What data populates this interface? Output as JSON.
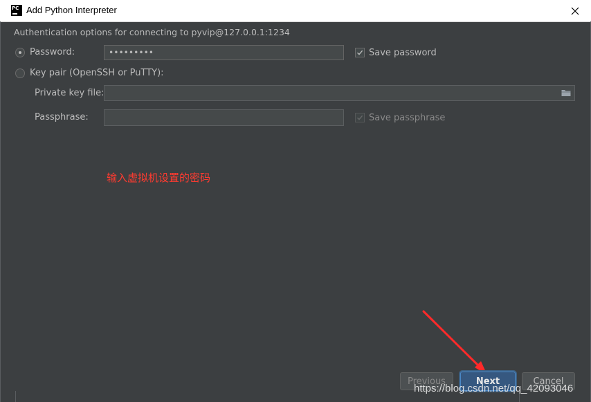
{
  "window": {
    "title": "Add Python Interpreter",
    "app_icon_text": "PC",
    "close_glyph": "✕"
  },
  "auth": {
    "header": "Authentication options for connecting to pyvip@127.0.0.1:1234",
    "password_option": "Password:",
    "password_value": "•••••••••",
    "save_password_label": "Save password",
    "save_password_checked": true,
    "keypair_option": "Key pair (OpenSSH or PuTTY):",
    "private_key_label": "Private key file:",
    "private_key_value": "",
    "passphrase_label": "Passphrase:",
    "passphrase_value": "",
    "save_passphrase_label": "Save passphrase",
    "save_passphrase_checked": true
  },
  "annotation": {
    "hint_text": "输入虚拟机设置的密码",
    "arrow_color": "#ff2a2a"
  },
  "footer": {
    "previous_label": "Previous",
    "next_label": "Next",
    "cancel_label": "Cancel",
    "watermark": "https://blog.csdn.net/qq_42093046"
  },
  "icons": {
    "folder": "folder-icon",
    "check": "check-icon",
    "close": "close-icon"
  },
  "colors": {
    "background": "#3c3f41",
    "field": "#45494a",
    "primary_button": "#365880",
    "hint": "#ff3b30"
  }
}
